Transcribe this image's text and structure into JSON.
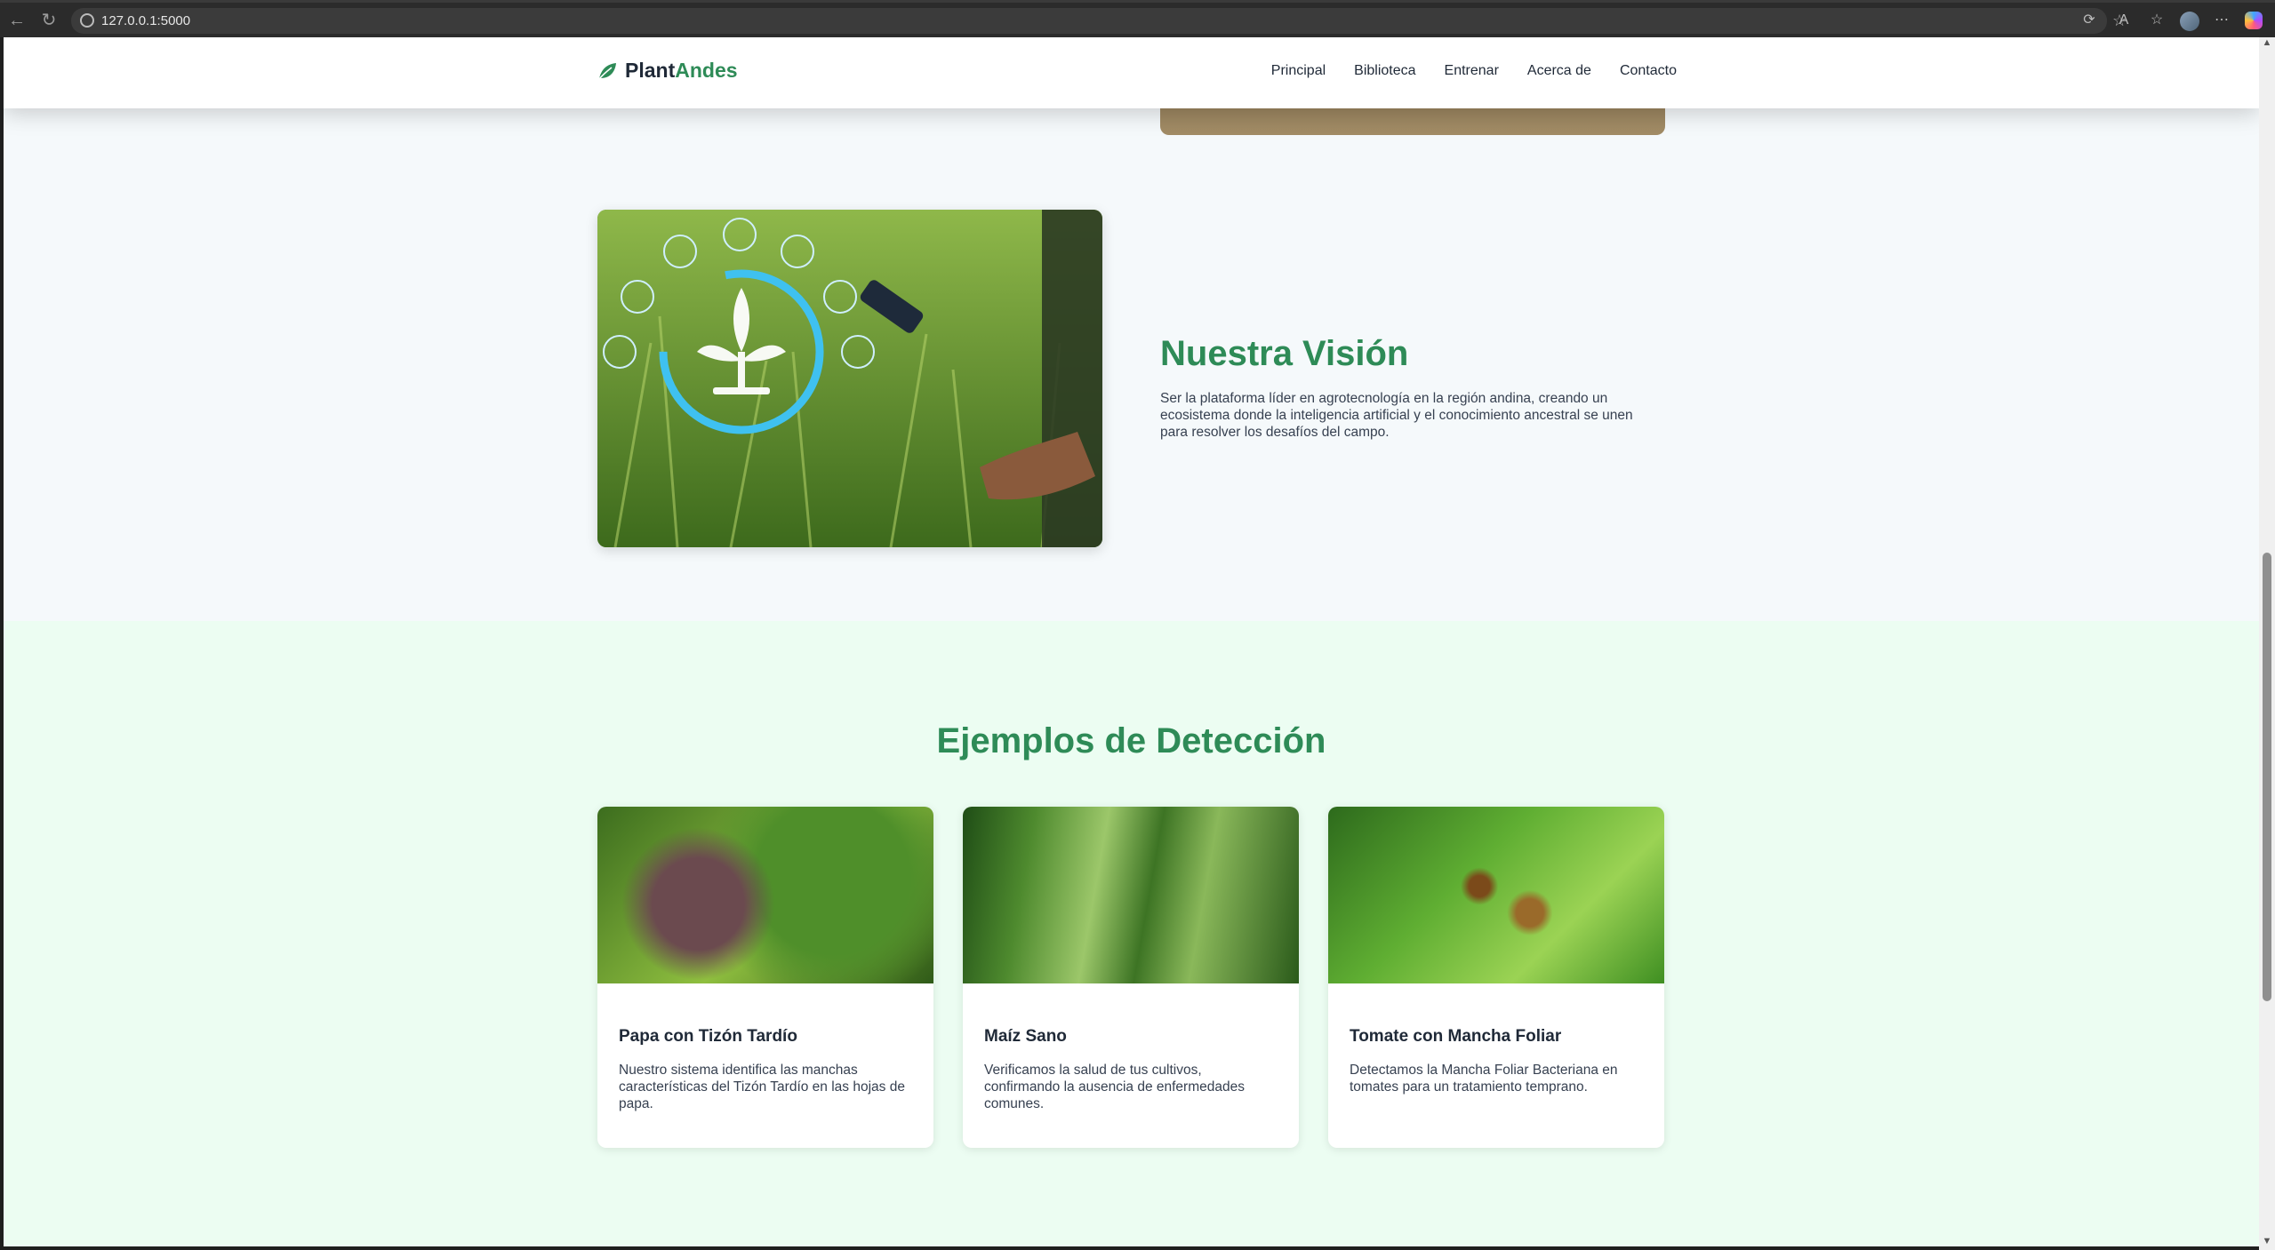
{
  "browser": {
    "url": "127.0.0.1:5000"
  },
  "site": {
    "logo_main": "Plant",
    "logo_accent": "Andes",
    "nav": [
      "Principal",
      "Biblioteca",
      "Entrenar",
      "Acerca de",
      "Contacto"
    ]
  },
  "vision": {
    "title": "Nuestra Visión",
    "text": "Ser la plataforma líder en agrotecnología en la región andina, creando un ecosistema donde la inteligencia artificial y el conocimiento ancestral se unen para resolver los desafíos del campo."
  },
  "examples": {
    "title": "Ejemplos de Detección",
    "cards": [
      {
        "title": "Papa con Tizón Tardío",
        "text": "Nuestro sistema identifica las manchas características del Tizón Tardío en las hojas de papa."
      },
      {
        "title": "Maíz Sano",
        "text": "Verificamos la salud de tus cultivos, confirmando la ausencia de enfermedades comunes."
      },
      {
        "title": "Tomate con Mancha Foliar",
        "text": "Detectamos la Mancha Foliar Bacteriana en tomates para un tratamiento temprano."
      }
    ]
  },
  "colors": {
    "brand_green": "#2e8b57",
    "section_bg": "#ecfdf2"
  }
}
